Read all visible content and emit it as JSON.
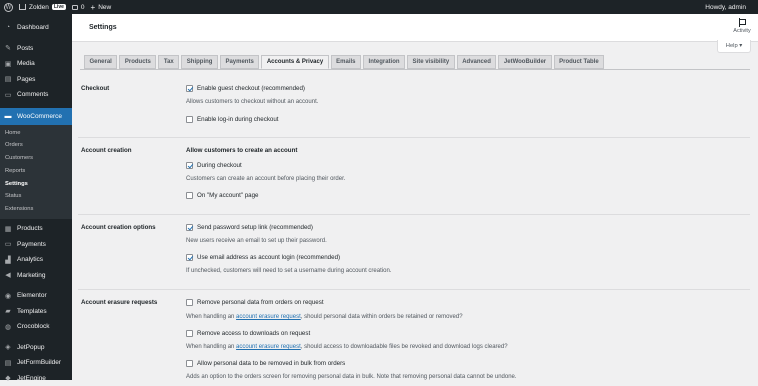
{
  "adminbar": {
    "site_name": "Zolden",
    "live_badge": "Live",
    "comments_count": "0",
    "new_label": "New",
    "howdy": "Howdy, admin"
  },
  "sidebar": {
    "items_top": [
      {
        "label": "Dashboard",
        "icon": "dashboard-icon"
      },
      {
        "label": "Posts",
        "icon": "pin-icon"
      },
      {
        "label": "Media",
        "icon": "media-icon"
      },
      {
        "label": "Pages",
        "icon": "page-icon"
      },
      {
        "label": "Comments",
        "icon": "comment-icon"
      }
    ],
    "woocommerce": "WooCommerce",
    "submenu": [
      "Home",
      "Orders",
      "Customers",
      "Reports",
      "Settings",
      "Status",
      "Extensions"
    ],
    "items_bottom": [
      {
        "label": "Products",
        "icon": "box-icon"
      },
      {
        "label": "Payments",
        "icon": "card-icon"
      },
      {
        "label": "Analytics",
        "icon": "chart-icon"
      },
      {
        "label": "Marketing",
        "icon": "megaphone-icon"
      },
      {
        "label": "Elementor",
        "icon": "elementor-icon"
      },
      {
        "label": "Templates",
        "icon": "folder-icon"
      },
      {
        "label": "Crocoblock",
        "icon": "croco-icon"
      },
      {
        "label": "JetPopup",
        "icon": "jet-icon"
      },
      {
        "label": "JetFormBuilder",
        "icon": "form-icon"
      },
      {
        "label": "JetEngine",
        "icon": "engine-icon"
      }
    ]
  },
  "header": {
    "title": "Settings",
    "activity": "Activity",
    "help": "Help ▾"
  },
  "tabs": [
    "General",
    "Products",
    "Tax",
    "Shipping",
    "Payments",
    "Accounts & Privacy",
    "Emails",
    "Integration",
    "Site visibility",
    "Advanced",
    "JetWooBuilder",
    "Product Table"
  ],
  "active_tab": "Accounts & Privacy",
  "sections": {
    "checkout": {
      "label": "Checkout",
      "guest": "Enable guest checkout (recommended)",
      "guest_desc": "Allows customers to checkout without an account.",
      "login": "Enable log-in during checkout"
    },
    "account_creation": {
      "label": "Account creation",
      "heading": "Allow customers to create an account",
      "during": "During checkout",
      "during_desc": "Customers can create an account before placing their order.",
      "myaccount": "On \"My account\" page"
    },
    "account_options": {
      "label": "Account creation options",
      "password": "Send password setup link (recommended)",
      "password_desc": "New users receive an email to set up their password.",
      "email_login": "Use email address as account login (recommended)",
      "email_login_desc": "If unchecked, customers will need to set a username during account creation."
    },
    "erasure": {
      "label": "Account erasure requests",
      "remove_orders": "Remove personal data from orders on request",
      "remove_orders_desc_pre": "When handling an ",
      "link": "account erasure request",
      "remove_orders_desc_post": ", should personal data within orders be retained or removed?",
      "remove_downloads": "Remove access to downloads on request",
      "remove_downloads_desc_pre": "When handling an ",
      "remove_downloads_desc_post": ", should access to downloadable files be revoked and download logs cleared?",
      "bulk": "Allow personal data to be removed in bulk from orders",
      "bulk_desc": "Adds an option to the orders screen for removing personal data in bulk. Note that removing personal data cannot be undone."
    }
  },
  "colors": {
    "adminbar": "#1d2327",
    "accent": "#2271b1",
    "background": "#f0f0f1"
  }
}
